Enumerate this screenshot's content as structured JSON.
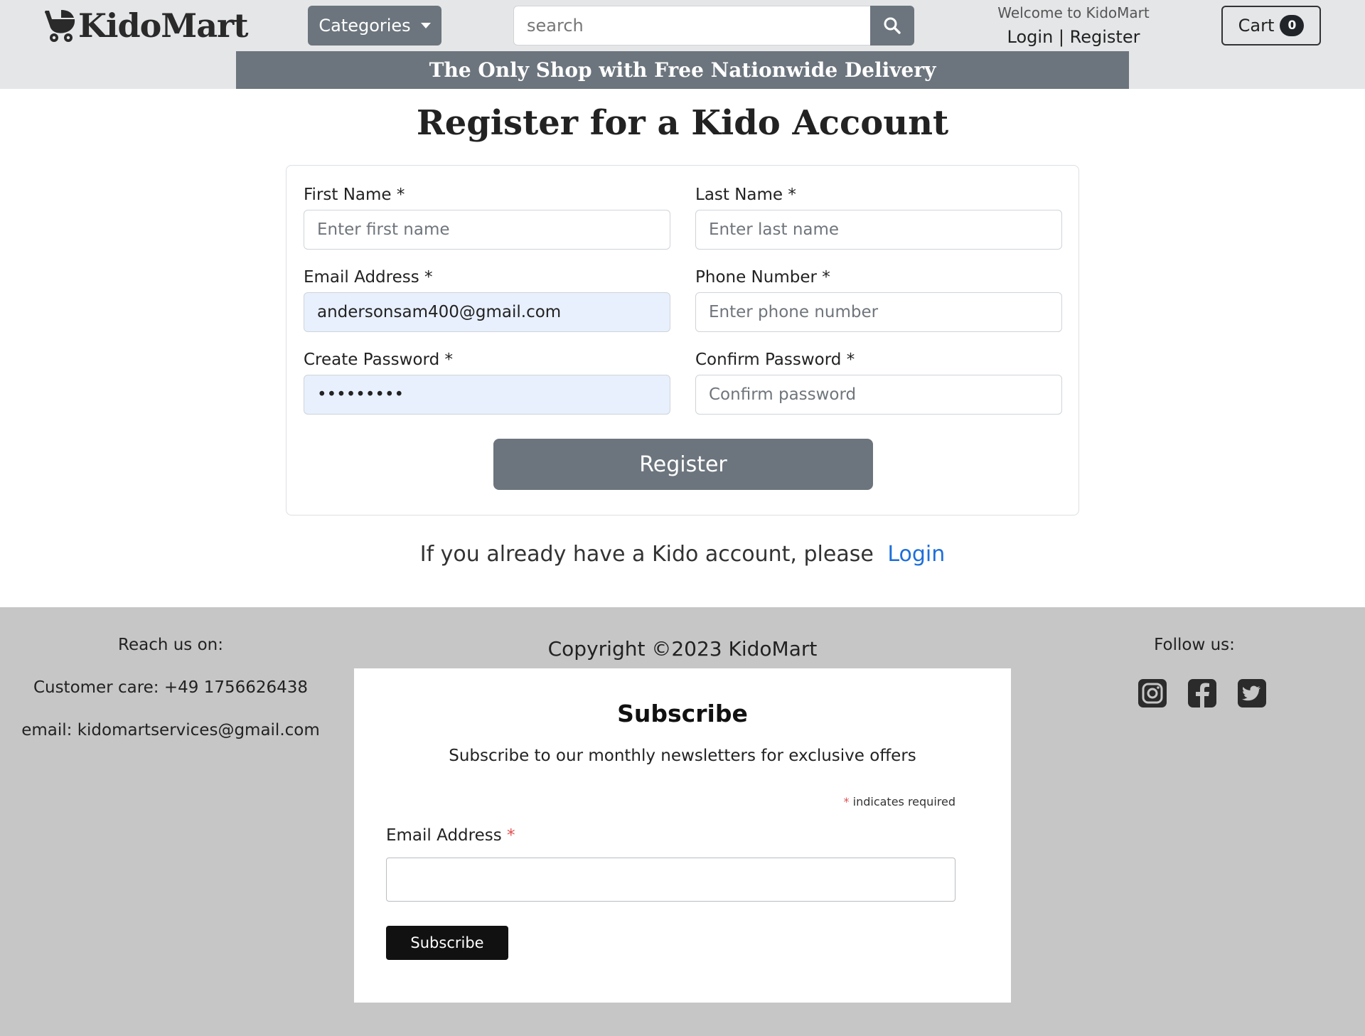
{
  "header": {
    "logo_text": "KidoMart",
    "categories_label": "Categories",
    "search": {
      "placeholder": "search"
    },
    "welcome": "Welcome to KidoMart",
    "login_label": "Login",
    "separator": "|",
    "register_label": "Register",
    "cart_label": "Cart",
    "cart_count": "0",
    "promo": "The Only Shop with Free Nationwide Delivery"
  },
  "main": {
    "title": "Register for a Kido Account",
    "form": {
      "first_name": {
        "label": "First Name *",
        "placeholder": "Enter first name",
        "value": ""
      },
      "last_name": {
        "label": "Last Name *",
        "placeholder": "Enter last name",
        "value": ""
      },
      "email": {
        "label": "Email Address *",
        "placeholder": "",
        "value": "andersonsam400@gmail.com"
      },
      "phone": {
        "label": "Phone Number *",
        "placeholder": "Enter phone number",
        "value": ""
      },
      "password": {
        "label": "Create Password *",
        "placeholder": "",
        "value": "•••••••••"
      },
      "confirm_password": {
        "label": "Confirm Password *",
        "placeholder": "Confirm password",
        "value": ""
      },
      "submit_label": "Register"
    },
    "already_text": "If you already have a Kido account, please",
    "already_link": "Login"
  },
  "footer": {
    "reach_title": "Reach us on:",
    "customer_care": "Customer care: +49 1756626438",
    "email_prefix": "email:",
    "email_value": "kidomartservices@gmail.com",
    "copyright": "Copyright ©2023 KidoMart",
    "follow_title": "Follow us:",
    "socials": [
      "instagram-icon",
      "facebook-icon",
      "twitter-icon"
    ],
    "subscribe": {
      "title": "Subscribe",
      "description": "Subscribe to our monthly newsletters for exclusive offers",
      "required_star": "*",
      "required_note": "indicates required",
      "email_label": "Email Address",
      "email_star": "*",
      "button_label": "Subscribe"
    }
  },
  "colors": {
    "header_bg": "#e5e6e8",
    "secondary": "#6c757d",
    "link": "#1e6fd9",
    "footer_bg": "#c6c6c6",
    "autofill_bg": "#e8f0fe",
    "required_star": "#e05050"
  }
}
